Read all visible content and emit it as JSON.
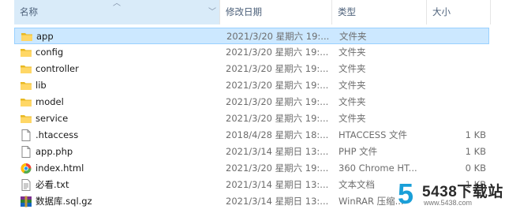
{
  "columns": {
    "name": "名称",
    "date": "修改日期",
    "type": "类型",
    "size": "大小"
  },
  "files": [
    {
      "name": "app",
      "date": "2021/3/20 星期六 19:...",
      "type": "文件夹",
      "size": "",
      "icon": "folder-icon",
      "selected": true
    },
    {
      "name": "config",
      "date": "2021/3/20 星期六 19:...",
      "type": "文件夹",
      "size": "",
      "icon": "folder-icon"
    },
    {
      "name": "controller",
      "date": "2021/3/20 星期六 19:...",
      "type": "文件夹",
      "size": "",
      "icon": "folder-icon"
    },
    {
      "name": "lib",
      "date": "2021/3/20 星期六 19:...",
      "type": "文件夹",
      "size": "",
      "icon": "folder-icon"
    },
    {
      "name": "model",
      "date": "2021/3/20 星期六 19:...",
      "type": "文件夹",
      "size": "",
      "icon": "folder-icon"
    },
    {
      "name": "service",
      "date": "2021/3/20 星期六 19:...",
      "type": "文件夹",
      "size": "",
      "icon": "folder-icon"
    },
    {
      "name": ".htaccess",
      "date": "2018/4/28 星期六 18:...",
      "type": "HTACCESS 文件",
      "size": "1 KB",
      "icon": "file-icon"
    },
    {
      "name": "app.php",
      "date": "2021/3/14 星期日 13:...",
      "type": "PHP 文件",
      "size": "1 KB",
      "icon": "file-icon"
    },
    {
      "name": "index.html",
      "date": "2021/3/20 星期六 19:...",
      "type": "360 Chrome HT...",
      "size": "0 KB",
      "icon": "chrome-html-icon"
    },
    {
      "name": "必看.txt",
      "date": "2021/3/14 星期日 13:...",
      "type": "文本文档",
      "size": "1 KB",
      "icon": "text-file-icon"
    },
    {
      "name": "数据库.sql.gz",
      "date": "2021/3/14 星期日 13:...",
      "type": "WinRAR 压缩...",
      "size": "",
      "icon": "winrar-icon"
    }
  ],
  "watermark": {
    "logo_digit": "5",
    "text": "5438下载站",
    "url": "www.5438.com"
  }
}
